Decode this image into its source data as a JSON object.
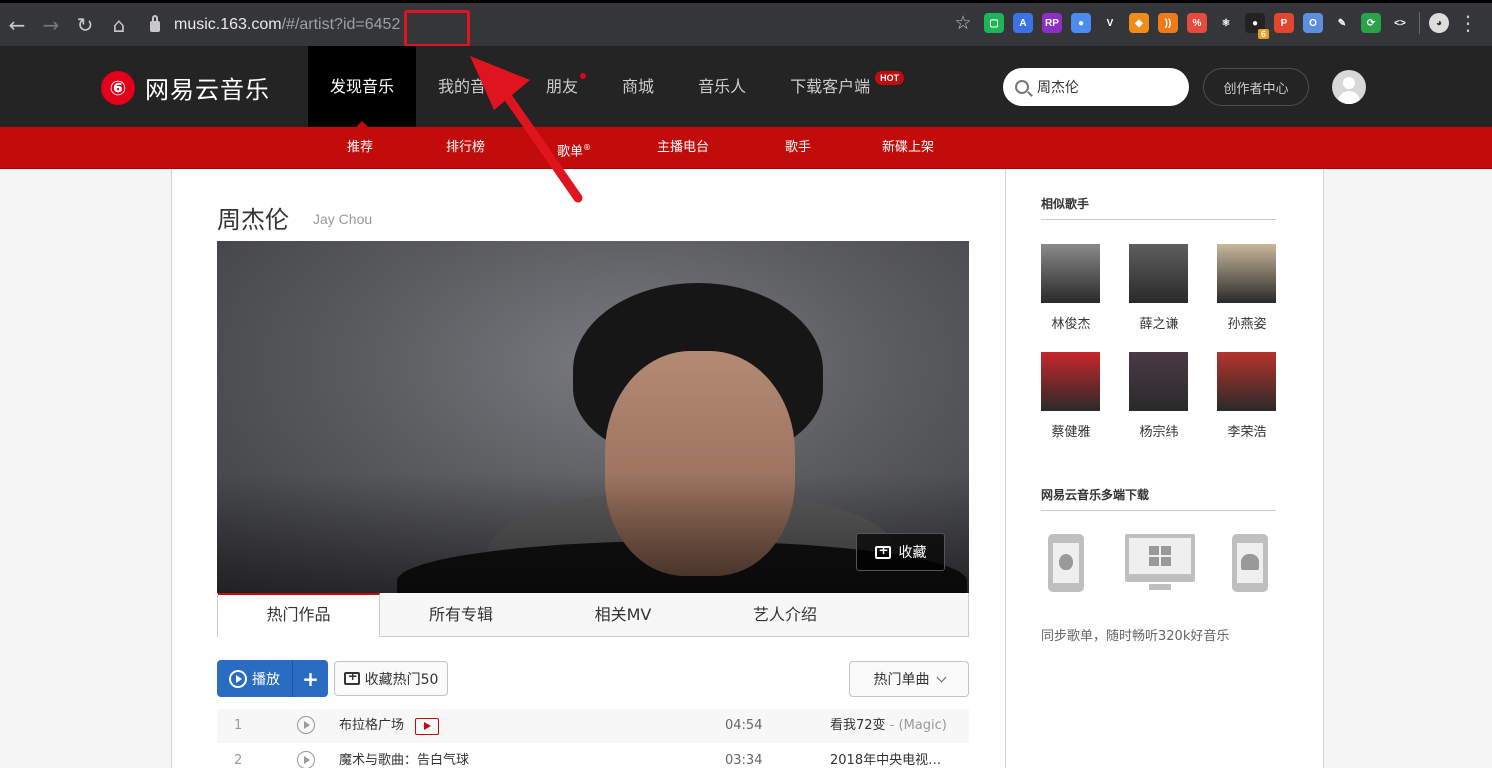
{
  "browser": {
    "url_host": "music.163.com",
    "url_path": "/#/artist?id=6452",
    "extensions": [
      {
        "name": "square-ext-icon",
        "color": "#1fb35a",
        "glyph": "▢"
      },
      {
        "name": "translate-ext-icon",
        "color": "#3b73e6",
        "glyph": "A"
      },
      {
        "name": "rp-ext-icon",
        "color": "#8d2fc2",
        "glyph": "RP"
      },
      {
        "name": "blue-circle-ext-icon",
        "color": "#4a8cf0",
        "glyph": "●"
      },
      {
        "name": "v-ext-icon",
        "color": "#35363a",
        "glyph": "V"
      },
      {
        "name": "mascot-ext-icon",
        "color": "#f08c1a",
        "glyph": "◆"
      },
      {
        "name": "rss-ext-icon",
        "color": "#ee7b1b",
        "glyph": "))"
      },
      {
        "name": "percent-ext-icon",
        "color": "#e64a3c",
        "glyph": "%"
      },
      {
        "name": "react-ext-icon",
        "color": "#35363a",
        "glyph": "⚛"
      },
      {
        "name": "badge-ext-icon",
        "color": "#222222",
        "glyph": "●"
      },
      {
        "name": "p-ext-icon",
        "color": "#e2462f",
        "glyph": "P"
      },
      {
        "name": "o-ext-icon",
        "color": "#5d8fe0",
        "glyph": "O"
      },
      {
        "name": "feather-ext-icon",
        "color": "#35363a",
        "glyph": "✎"
      },
      {
        "name": "refresh-ext-icon",
        "color": "#2aa14b",
        "glyph": "⟳"
      },
      {
        "name": "code-ext-icon",
        "color": "#35363a",
        "glyph": "<>"
      }
    ],
    "badge_count": "6"
  },
  "site": {
    "logo_text": "网易云音乐",
    "logo_glyph": "⑥",
    "nav": [
      {
        "label": "发现音乐"
      },
      {
        "label": "我的音乐"
      },
      {
        "label": "朋友"
      },
      {
        "label": "商城"
      },
      {
        "label": "音乐人"
      },
      {
        "label": "下载客户端"
      }
    ],
    "hot_badge": "HOT",
    "search_value": "周杰伦",
    "creator_label": "创作者中心",
    "subnav": [
      {
        "label": "推荐"
      },
      {
        "label": "排行榜"
      },
      {
        "label": "歌单"
      },
      {
        "label": "主播电台"
      },
      {
        "label": "歌手"
      },
      {
        "label": "新碟上架"
      }
    ],
    "subnav_reg": "®"
  },
  "artist": {
    "name": "周杰伦",
    "name_en": "Jay Chou",
    "collect_label": "收藏",
    "tabs": [
      {
        "label": "热门作品"
      },
      {
        "label": "所有专辑"
      },
      {
        "label": "相关MV"
      },
      {
        "label": "艺人介绍"
      }
    ],
    "play_label": "播放",
    "add_label": "+",
    "fav_hot_label": "收藏热门50",
    "sort_label": "热门单曲",
    "songs": [
      {
        "num": "1",
        "title": "布拉格广场",
        "duration": "04:54",
        "album": "看我72变",
        "album_extra": " - (Magic)"
      },
      {
        "num": "2",
        "title": "魔术与歌曲：告白气球",
        "duration": "03:34",
        "album": "2018年中央电视…",
        "album_extra": ""
      }
    ]
  },
  "sidebar": {
    "similar_title": "相似歌手",
    "singers": [
      {
        "name": "林俊杰",
        "color": "#8a8a8a"
      },
      {
        "name": "薛之谦",
        "color": "#5e5e5e"
      },
      {
        "name": "孙燕姿",
        "color": "#c8b79a"
      },
      {
        "name": "蔡健雅",
        "color": "#c8262b"
      },
      {
        "name": "杨宗纬",
        "color": "#4a3a46"
      },
      {
        "name": "李荣浩",
        "color": "#b5332a"
      }
    ],
    "download_title": "网易云音乐多端下载",
    "download_desc": "同步歌单，随时畅听320k好音乐"
  }
}
